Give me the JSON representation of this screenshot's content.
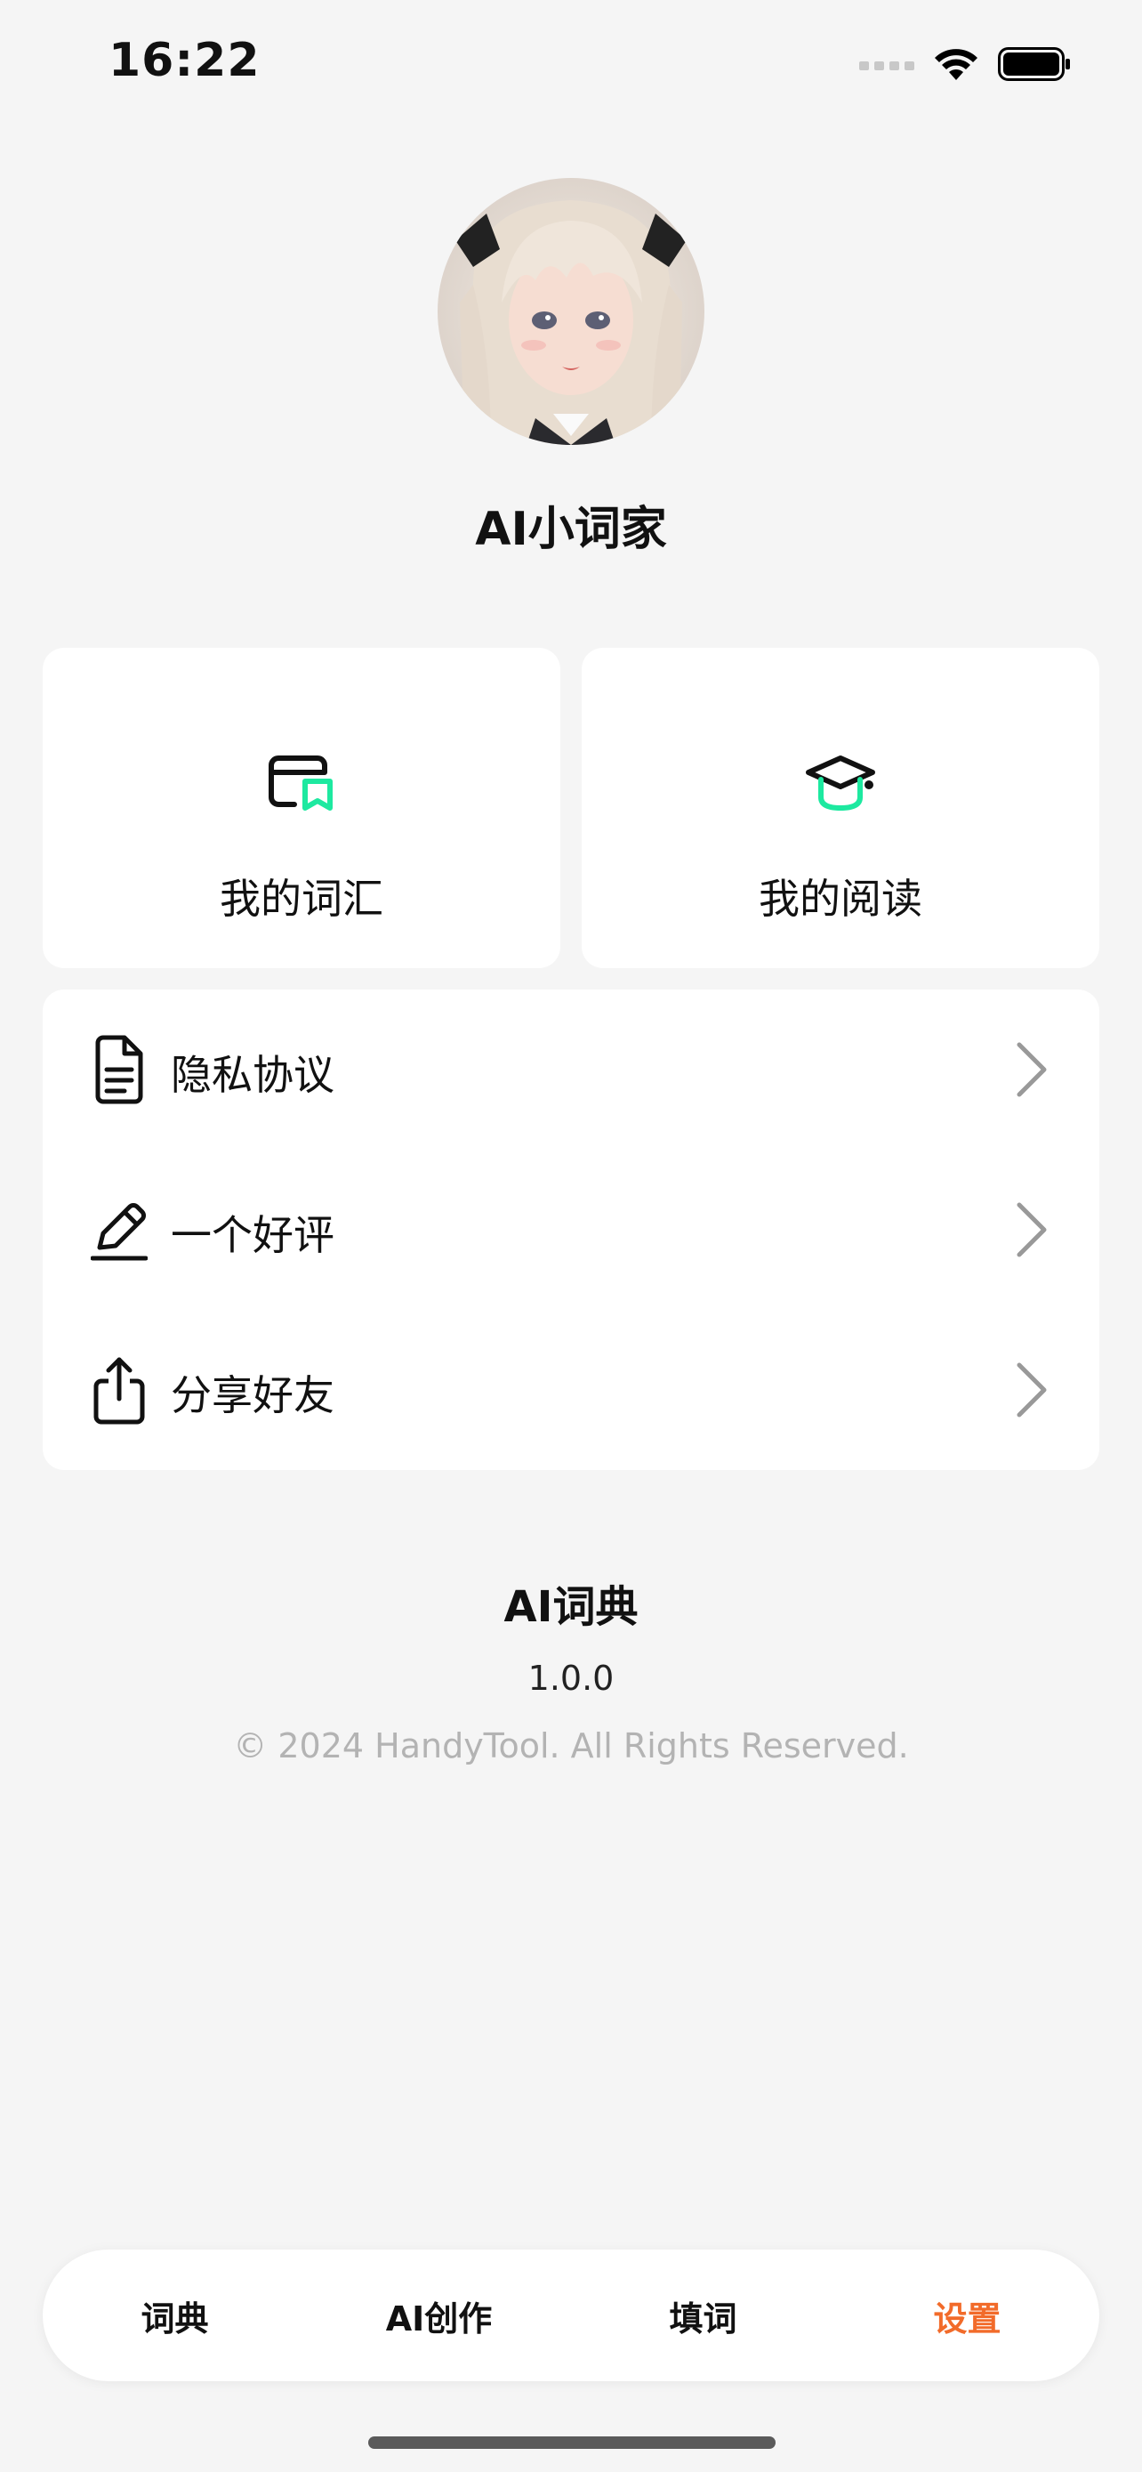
{
  "status_bar": {
    "time": "16:22"
  },
  "profile": {
    "name": "AI小词家"
  },
  "cards": [
    {
      "label": "我的词汇",
      "icon": "wordbook-icon"
    },
    {
      "label": "我的阅读",
      "icon": "graduation-cap-icon"
    }
  ],
  "menu": {
    "items": [
      {
        "label": "隐私协议",
        "icon": "document-icon"
      },
      {
        "label": "一个好评",
        "icon": "pencil-icon"
      },
      {
        "label": "分享好友",
        "icon": "share-icon"
      }
    ]
  },
  "footer": {
    "app_title": "AI词典",
    "version": "1.0.0",
    "copyright": "© 2024 HandyTool. All Rights Reserved."
  },
  "tabbar": {
    "tabs": [
      {
        "label": "词典"
      },
      {
        "label": "AI创作"
      },
      {
        "label": "填词"
      },
      {
        "label": "设置"
      }
    ],
    "active_index": 3
  },
  "colors": {
    "accent": "#f26b2a",
    "green": "#1de9a0",
    "background": "#f5f5f5"
  }
}
